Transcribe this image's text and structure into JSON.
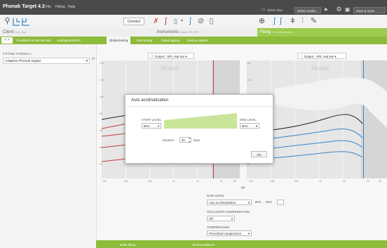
{
  "titlebar": {
    "app_name": "Phonak Target 4.3",
    "menu": [
      "File",
      "Fitting",
      "Help"
    ],
    "client_view": "Client view",
    "select_media": "Select media...",
    "save_close": "Save & close session"
  },
  "toolbar": {
    "connect_label": "Connect"
  },
  "header": {
    "client_label": "Client",
    "client_name": "Doe, Sue",
    "instruments_label": "Instruments",
    "instruments_detail": "Naida V90-RIC",
    "fitting_label": "Fitting",
    "fitting_detail": "CI Calm situation"
  },
  "tabs": [
    {
      "label": "Feedback & real ear test"
    },
    {
      "label": "AudiogramDirect"
    },
    {
      "label": "Global tuning"
    },
    {
      "label": "Fine tuning"
    },
    {
      "label": "DataLogging"
    },
    {
      "label": "Device options"
    }
  ],
  "left_panel": {
    "fitting_formula_label": "FITTING FORMULA",
    "fitting_formula_value": "Adaptive Phonak Digital"
  },
  "charts": {
    "right": {
      "output_label": "Output - SPL real ear",
      "muted": "Muted"
    },
    "left": {
      "output_label": "Output - SPL real ear",
      "muted": "Muted"
    },
    "y_ticks": [
      "140",
      "120",
      "100",
      "80",
      "60",
      "40",
      "20"
    ],
    "x_ticks": [
      "125",
      "250",
      "500",
      "1k",
      "2k",
      "4k",
      "8k"
    ]
  },
  "colors": {
    "right_curves": "#c43a3a",
    "left_curves": "#3b84c4",
    "accent": "#8dbb3a",
    "dialog_ramp": "#c9e59a"
  },
  "bottom_controls": {
    "gain_level_label": "GAIN LEVEL",
    "gain_level_value": "Auto acclimatization",
    "gain_range": "80% → 90%",
    "more_button": "...",
    "occlusion_label": "OCCLUSION COMPENSATION",
    "occlusion_value": "Off",
    "compression_label": "COMPRESSION",
    "compression_value": "Prescribed compression"
  },
  "dialog": {
    "title": "Auto acclimatization",
    "start_label": "START LEVEL",
    "start_value": "80%",
    "end_label": "END LEVEL",
    "end_value": "90%",
    "duration_label": "Duration",
    "duration_value": "30",
    "duration_unit": "days",
    "ok_label": "OK"
  },
  "bottom_tabs": [
    {
      "label": "Initial fitting"
    },
    {
      "label": "Tinnitus balance"
    }
  ]
}
